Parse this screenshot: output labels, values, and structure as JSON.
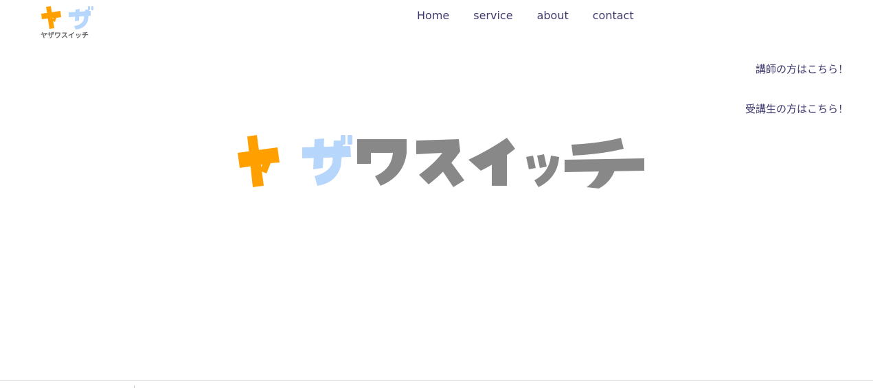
{
  "brand": {
    "logo_text": "ヤザ",
    "logo_subtext": "ヤザワスイッチ",
    "hero_text": "ヤザワスイッチ",
    "colors": {
      "ya": "#ffa000",
      "za": "#b6d6fb",
      "rest": "#888888"
    }
  },
  "nav": {
    "items": [
      {
        "label": "Home"
      },
      {
        "label": "service"
      },
      {
        "label": "about"
      },
      {
        "label": "contact"
      }
    ],
    "color": "#3e3a6e"
  },
  "side_links": {
    "teacher": "講師の方はこちら！",
    "student": "受講生の方はこちら！"
  }
}
